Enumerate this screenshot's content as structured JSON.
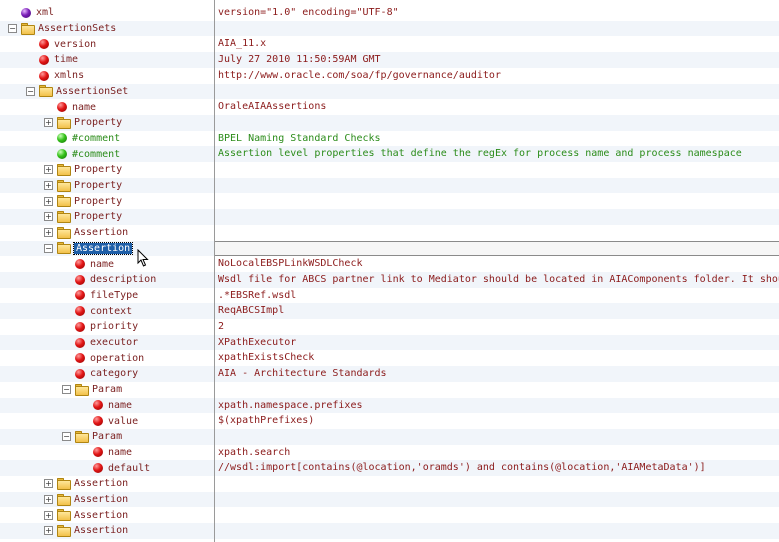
{
  "tree": [
    {
      "label": "xml",
      "icon": "purple",
      "depth": 0,
      "exp": "",
      "value": "version=\"1.0\" encoding=\"UTF-8\""
    },
    {
      "label": "AssertionSets",
      "icon": "folder",
      "depth": 0,
      "exp": "−",
      "value": ""
    },
    {
      "label": "version",
      "icon": "red",
      "depth": 1,
      "exp": "",
      "value": "AIA_11.x"
    },
    {
      "label": "time",
      "icon": "red",
      "depth": 1,
      "exp": "",
      "value": "July 27 2010 11:50:59AM GMT"
    },
    {
      "label": "xmlns",
      "icon": "red",
      "depth": 1,
      "exp": "",
      "value": "http://www.oracle.com/soa/fp/governance/auditor"
    },
    {
      "label": "AssertionSet",
      "icon": "folder",
      "depth": 1,
      "exp": "−",
      "value": ""
    },
    {
      "label": "name",
      "icon": "red",
      "depth": 2,
      "exp": "",
      "value": "OraleAIAAssertions"
    },
    {
      "label": "Property",
      "icon": "folder",
      "depth": 2,
      "exp": "+",
      "value": ""
    },
    {
      "label": "#comment",
      "icon": "green",
      "depth": 2,
      "exp": "",
      "value": "BPEL Naming Standard Checks"
    },
    {
      "label": "#comment",
      "icon": "green",
      "depth": 2,
      "exp": "",
      "value": "Assertion level properties that define the regEx for process name and process namespace"
    },
    {
      "label": "Property",
      "icon": "folder",
      "depth": 2,
      "exp": "+",
      "value": ""
    },
    {
      "label": "Property",
      "icon": "folder",
      "depth": 2,
      "exp": "+",
      "value": ""
    },
    {
      "label": "Property",
      "icon": "folder",
      "depth": 2,
      "exp": "+",
      "value": ""
    },
    {
      "label": "Property",
      "icon": "folder",
      "depth": 2,
      "exp": "+",
      "value": ""
    },
    {
      "label": "Assertion",
      "icon": "folder",
      "depth": 2,
      "exp": "+",
      "value": ""
    },
    {
      "label": "Assertion",
      "icon": "folder",
      "depth": 2,
      "exp": "−",
      "value": "",
      "selected": true
    },
    {
      "label": "name",
      "icon": "red",
      "depth": 3,
      "exp": "",
      "value": "NoLocalEBSPLinkWSDLCheck"
    },
    {
      "label": "description",
      "icon": "red",
      "depth": 3,
      "exp": "",
      "value": "Wsdl file for ABCS partner link to Mediator should be located in AIAComponents folder. It should not be local."
    },
    {
      "label": "fileType",
      "icon": "red",
      "depth": 3,
      "exp": "",
      "value": ".*EBSRef.wsdl"
    },
    {
      "label": "context",
      "icon": "red",
      "depth": 3,
      "exp": "",
      "value": "ReqABCSImpl"
    },
    {
      "label": "priority",
      "icon": "red",
      "depth": 3,
      "exp": "",
      "value": "2"
    },
    {
      "label": "executor",
      "icon": "red",
      "depth": 3,
      "exp": "",
      "value": "XPathExecutor"
    },
    {
      "label": "operation",
      "icon": "red",
      "depth": 3,
      "exp": "",
      "value": "xpathExistsCheck"
    },
    {
      "label": "category",
      "icon": "red",
      "depth": 3,
      "exp": "",
      "value": "AIA - Architecture Standards"
    },
    {
      "label": "Param",
      "icon": "folder",
      "depth": 3,
      "exp": "−",
      "value": ""
    },
    {
      "label": "name",
      "icon": "red",
      "depth": 4,
      "exp": "",
      "value": "xpath.namespace.prefixes"
    },
    {
      "label": "value",
      "icon": "red",
      "depth": 4,
      "exp": "",
      "value": "$(xpathPrefixes)"
    },
    {
      "label": "Param",
      "icon": "folder",
      "depth": 3,
      "exp": "−",
      "value": ""
    },
    {
      "label": "name",
      "icon": "red",
      "depth": 4,
      "exp": "",
      "value": "xpath.search"
    },
    {
      "label": "default",
      "icon": "red",
      "depth": 4,
      "exp": "",
      "value": "//wsdl:import[contains(@location,'oramds') and contains(@location,'AIAMetaData')]"
    },
    {
      "label": "Assertion",
      "icon": "folder",
      "depth": 2,
      "exp": "+",
      "value": ""
    },
    {
      "label": "Assertion",
      "icon": "folder",
      "depth": 2,
      "exp": "+",
      "value": ""
    },
    {
      "label": "Assertion",
      "icon": "folder",
      "depth": 2,
      "exp": "+",
      "value": ""
    },
    {
      "label": "Assertion",
      "icon": "folder",
      "depth": 2,
      "exp": "+",
      "value": ""
    }
  ]
}
